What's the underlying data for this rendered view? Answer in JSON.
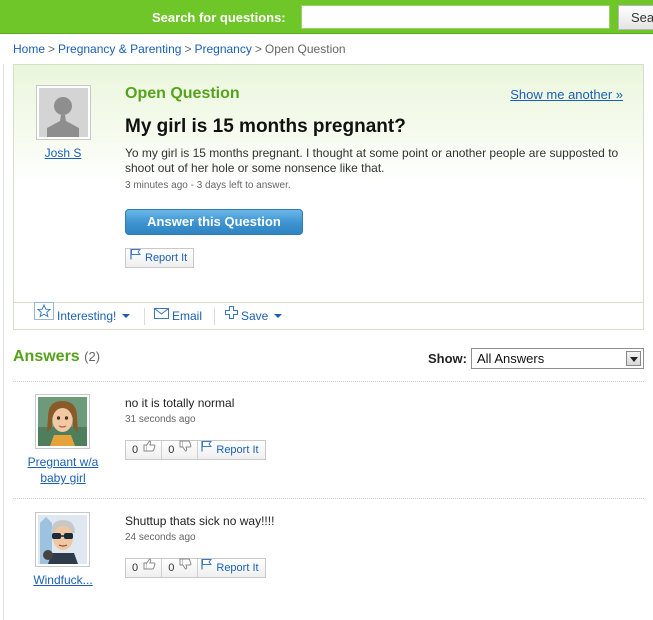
{
  "search": {
    "label": "Search for questions:",
    "placeholder": "",
    "button_label": "Sea"
  },
  "breadcrumb": {
    "items": [
      "Home",
      "Pregnancy & Parenting",
      "Pregnancy"
    ],
    "separator": ">",
    "current": "Open Question"
  },
  "question": {
    "status": "Open Question",
    "show_another": "Show me another »",
    "title": "My girl is 15 months pregnant?",
    "body": "Yo my girl is 15 months pregnant. I thought at some point or another people are supposted to shoot out of her hole or some nonsence like that.",
    "meta": "3 minutes ago - 3 days left to answer.",
    "answer_button": "Answer this Question",
    "report_label": "Report It",
    "asker": {
      "name": "Josh S",
      "avatar": "default-silhouette-avatar"
    },
    "toolbar": {
      "interesting": "Interesting!",
      "email": "Email",
      "save": "Save"
    }
  },
  "answers": {
    "heading": "Answers",
    "count": "(2)",
    "show_label": "Show:",
    "filter_selected": "All Answers",
    "items": [
      {
        "user": "Pregnant w/a baby girl",
        "text": "no it is totally normal",
        "time": "31 seconds ago",
        "thumbs_up": "0",
        "thumbs_down": "0",
        "report": "Report It",
        "avatar": "female-avatar"
      },
      {
        "user": "Windfuck...",
        "text": "Shuttup thats sick no way!!!!",
        "time": "24 seconds ago",
        "thumbs_up": "0",
        "thumbs_down": "0",
        "report": "Report It",
        "avatar": "male-sunglasses-avatar"
      }
    ]
  },
  "colors": {
    "brand_green": "#6fc629",
    "heading_green": "#56a31b",
    "link_blue": "#1b5fb4",
    "button_blue": "#3c93cf"
  }
}
